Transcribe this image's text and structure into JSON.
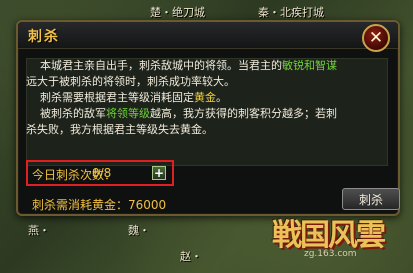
{
  "map": {
    "labels": [
      "楚・绝刀城",
      "秦・北疾打城",
      "燕・",
      "魏・",
      "赵・"
    ]
  },
  "dialog": {
    "title": "刺杀",
    "description": {
      "line1a": "本城君主亲自出手，刺杀敌城中的将领。当君主的",
      "line1b": "敏锐和智谋",
      "line2": "远大于被刺杀的将领时，刺杀成功率较大。",
      "line3a": "刺杀需要根据君主等级消耗固定",
      "line3b": "黄金",
      "line3c": "。",
      "line4a": "被刺杀的敌军",
      "line4b": "将领等级",
      "line4c": "越高，我方获得的刺客积分越多；若刺",
      "line5": "杀失败，我方根据君主等级失去黄金。"
    },
    "count_label": "今日刺杀次数：",
    "count_value": "0/8",
    "plus_symbol": "+",
    "cost_label": "刺杀需消耗黄金：",
    "cost_value": "76000",
    "assassinate_button": "刺杀",
    "close_symbol": "✕"
  },
  "logo": {
    "text": "戦国风雲",
    "subtext": "zg.163.com"
  },
  "colors": {
    "title": "#f0c04a",
    "highlight_green": "#6fd33a",
    "highlight_yellow": "#f2d13a",
    "count_box_border": "#e02020"
  }
}
